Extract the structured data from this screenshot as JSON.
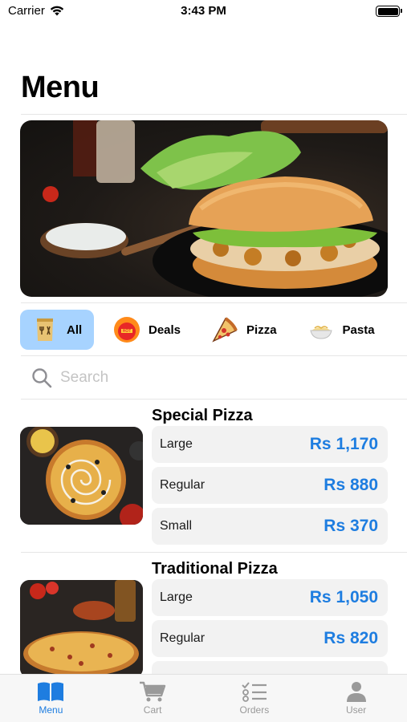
{
  "status_bar": {
    "carrier": "Carrier",
    "time": "3:43 PM"
  },
  "page": {
    "title": "Menu"
  },
  "categories": [
    {
      "label": "All",
      "icon": "menu-card-icon",
      "active": true
    },
    {
      "label": "Deals",
      "icon": "hot-deals-icon",
      "active": false
    },
    {
      "label": "Pizza",
      "icon": "pizza-slice-icon",
      "active": false
    },
    {
      "label": "Pasta",
      "icon": "pasta-bowl-icon",
      "active": false
    }
  ],
  "search": {
    "placeholder": "Search"
  },
  "products": [
    {
      "name": "Special Pizza",
      "sizes": [
        {
          "label": "Large",
          "price": "Rs 1,170"
        },
        {
          "label": "Regular",
          "price": "Rs 880"
        },
        {
          "label": "Small",
          "price": "Rs 370"
        }
      ]
    },
    {
      "name": "Traditional Pizza",
      "sizes": [
        {
          "label": "Large",
          "price": "Rs 1,050"
        },
        {
          "label": "Regular",
          "price": "Rs 820"
        }
      ]
    }
  ],
  "tabbar": [
    {
      "label": "Menu",
      "icon": "book-icon",
      "active": true
    },
    {
      "label": "Cart",
      "icon": "cart-icon",
      "active": false
    },
    {
      "label": "Orders",
      "icon": "checklist-icon",
      "active": false
    },
    {
      "label": "User",
      "icon": "person-icon",
      "active": false
    }
  ],
  "colors": {
    "accent": "#1e7de0",
    "chip_active": "#a7d3ff",
    "row_bg": "#f2f2f2"
  }
}
